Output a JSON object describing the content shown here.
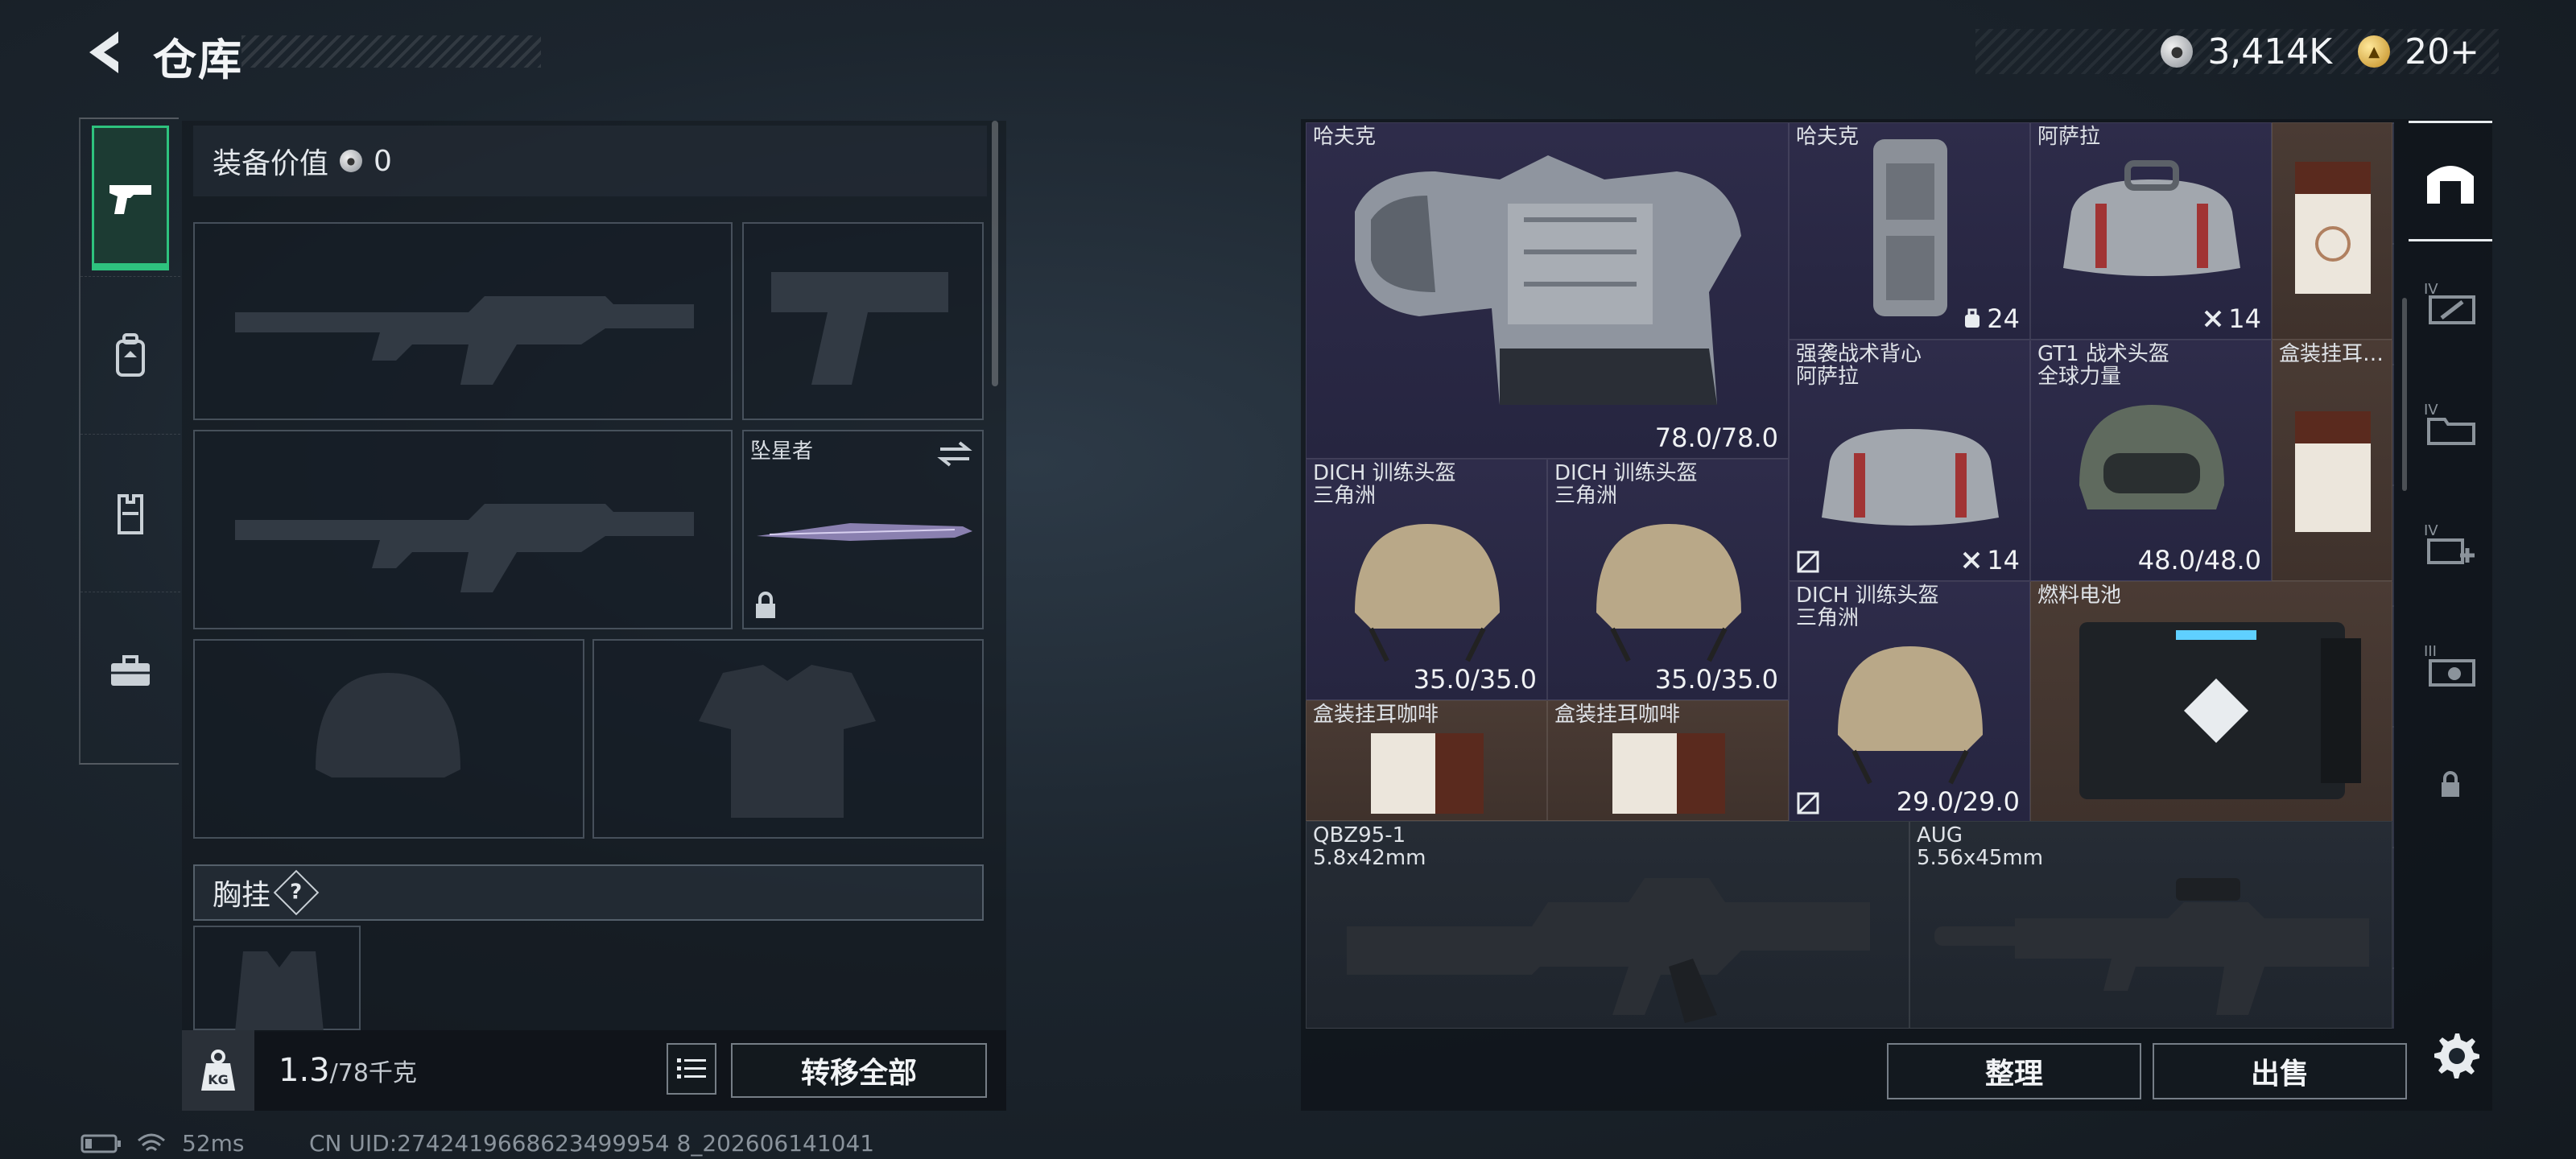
{
  "header": {
    "title": "仓库",
    "silver_amount": "3,414K",
    "gold_amount": "20+"
  },
  "left_nav": {
    "items": [
      "pistol-icon",
      "backpack-icon",
      "vest-icon",
      "toolbox-icon"
    ],
    "active": 0
  },
  "equipment": {
    "value_label": "装备价值",
    "value": "0",
    "melee_label": "坠星者",
    "chest_rig_label": "胸挂",
    "chest_rig_help": "?"
  },
  "carry": {
    "weight": "1.3",
    "max_weight": "/78千克",
    "transfer_all": "转移全部"
  },
  "storage": {
    "items": [
      {
        "name": "哈夫克",
        "value": "78.0/78.0",
        "color": "purple"
      },
      {
        "name": "哈夫克",
        "badge": "24",
        "color": "purple"
      },
      {
        "name": "阿萨拉",
        "badge": "14",
        "color": "purple"
      },
      {
        "name": "",
        "color": "brown"
      },
      {
        "name": "强袭战术背心",
        "sub": "阿萨拉",
        "badge": "14",
        "color": "purple"
      },
      {
        "name": "GT1 战术头盔",
        "sub": "全球力量",
        "value": "48.0/48.0",
        "color": "purple"
      },
      {
        "name": "盒装挂耳…",
        "color": "brown"
      },
      {
        "name": "DICH 训练头盔",
        "sub": "三角洲",
        "value": "35.0/35.0",
        "color": "purple"
      },
      {
        "name": "DICH 训练头盔",
        "sub": "三角洲",
        "value": "35.0/35.0",
        "color": "purple"
      },
      {
        "name": "DICH 训练头盔",
        "sub": "三角洲",
        "value": "29.0/29.0",
        "color": "purple"
      },
      {
        "name": "燃料电池",
        "color": "brown"
      },
      {
        "name": "盒装挂耳咖啡",
        "color": "brown"
      },
      {
        "name": "盒装挂耳咖啡",
        "color": "brown"
      },
      {
        "name": "QBZ95-1",
        "sub": "5.8x42mm",
        "color": "gray"
      },
      {
        "name": "AUG",
        "sub": "5.56x45mm",
        "color": "gray"
      }
    ],
    "sort_button": "整理",
    "sell_button": "出售"
  },
  "status_bar": {
    "ping": "52ms",
    "uid": "CN UID:2742419668623499954 8_202606141041"
  },
  "colors": {
    "accent_green": "#2ec27e",
    "purple_cell": "#2e2c4a",
    "brown_cell": "#4a3b34"
  }
}
